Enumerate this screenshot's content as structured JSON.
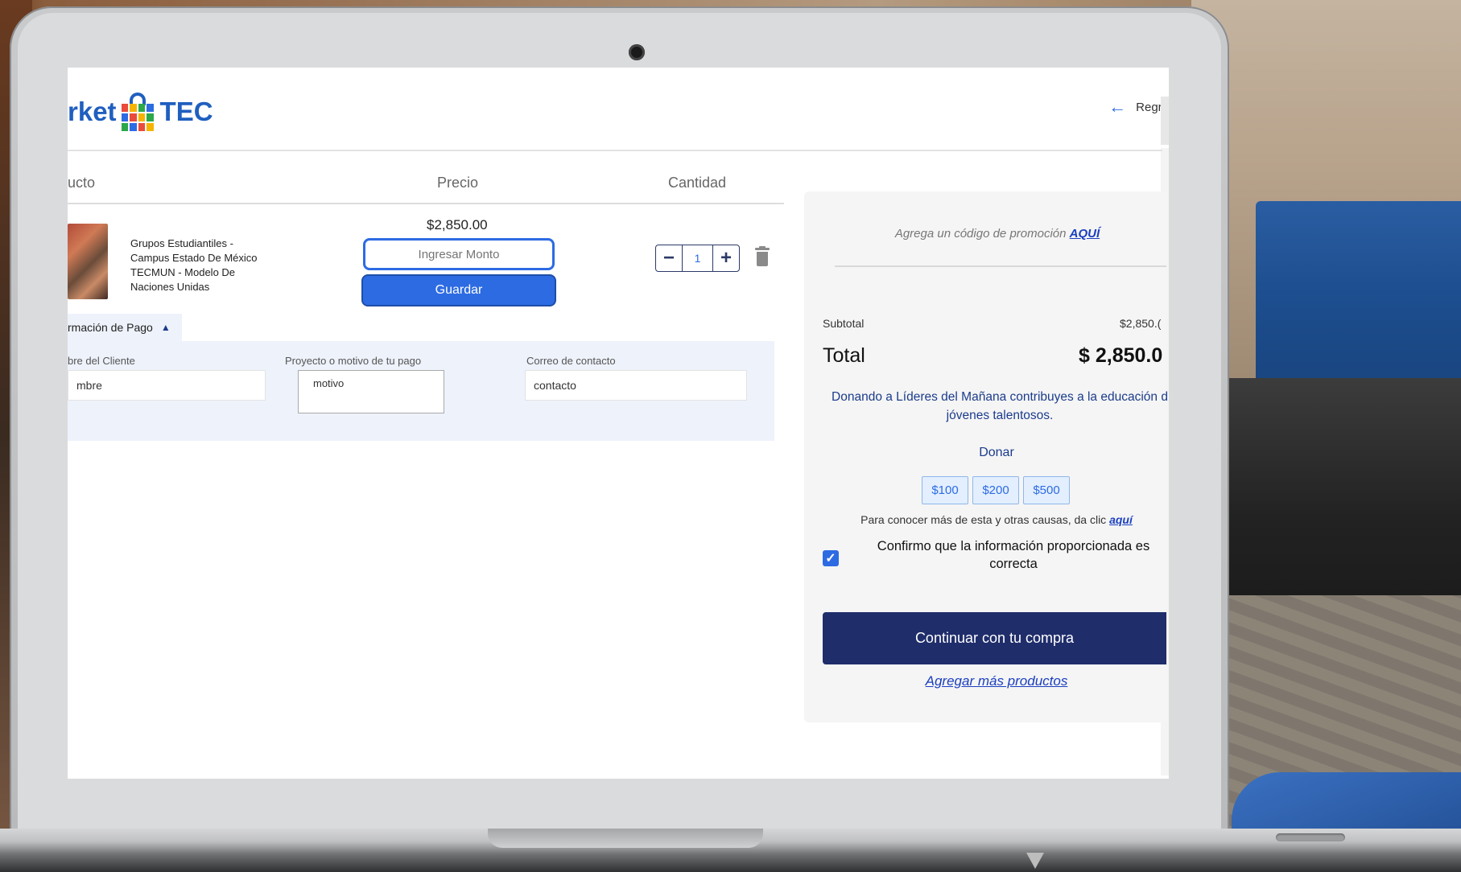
{
  "header": {
    "logo_prefix": "rket",
    "logo_suffix": "TEC",
    "back_label": "Regre"
  },
  "cart": {
    "columns": {
      "product": "ucto",
      "price": "Precio",
      "quantity": "Cantidad"
    },
    "item": {
      "name": "Grupos Estudiantiles - Campus Estado De México TECMUN - Modelo De Naciones Unidas",
      "price": "$2,850.00",
      "amount_placeholder": "Ingresar Monto",
      "save_label": "Guardar",
      "quantity": "1"
    }
  },
  "payment_info": {
    "tab_label": "rmación de Pago",
    "client_label": "bre del Cliente",
    "client_value": "mbre",
    "project_label": "Proyecto o motivo de tu pago",
    "project_value": "motivo",
    "email_label": "Correo de contacto",
    "email_value": "contacto"
  },
  "summary": {
    "promo_text": "Agrega un código de promoción",
    "promo_link": "AQUÍ",
    "subtotal_label": "Subtotal",
    "subtotal_value": "$2,850.(",
    "total_label": "Total",
    "total_value": "$ 2,850.0",
    "donate_text": "Donando a Líderes del Mañana contribuyes a la educación d jóvenes talentosos.",
    "donate_label": "Donar",
    "donation_options": [
      "$100",
      "$200",
      "$500"
    ],
    "more_causes_text": "Para conocer más de esta y otras causas, da clic",
    "more_causes_link": "aquí",
    "confirm_text": "Confirmo que la información proporcionada es correcta",
    "confirm_checked": true,
    "continue_label": "Continuar con tu compra",
    "add_more_label": "Agregar más productos"
  },
  "colors": {
    "primary_blue": "#2d6be3",
    "navy": "#1f2d6b",
    "panel_bg": "#f5f5f5",
    "payment_bg": "#eef2fb"
  }
}
